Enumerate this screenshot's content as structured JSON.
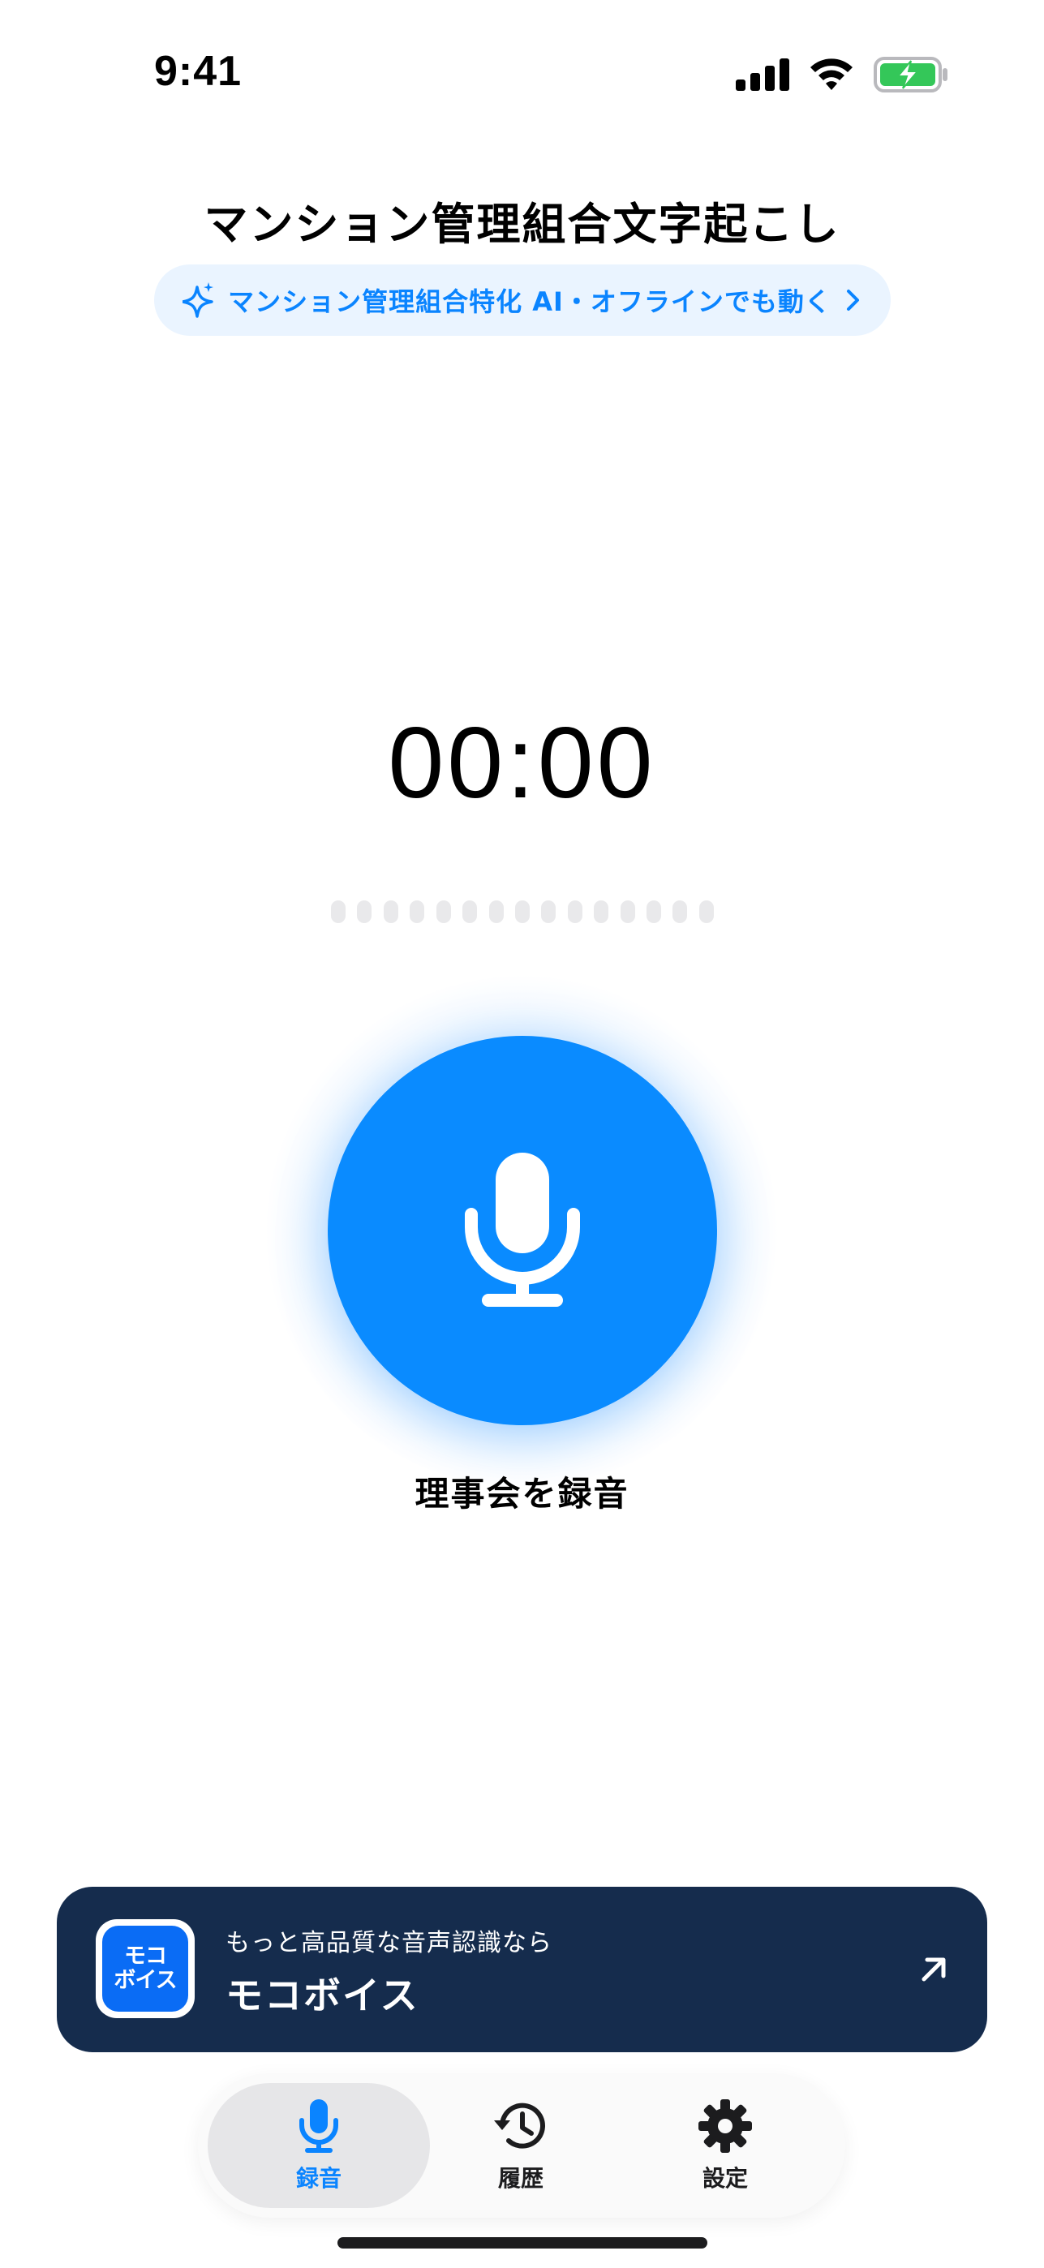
{
  "status_bar": {
    "time": "9:41",
    "icons": [
      "cellular-signal-icon",
      "wifi-icon",
      "battery-charging-icon"
    ]
  },
  "header": {
    "title": "マンション管理組合文字起こし",
    "ai_pill": {
      "icon": "sparkle-icon",
      "label": "マンション管理組合特化 AI・オフラインでも動く",
      "chevron": "chevron-right-icon"
    }
  },
  "recorder": {
    "timer": "00:00",
    "level_meter_dot_count": 15,
    "button_icon": "microphone-icon",
    "label": "理事会を録音"
  },
  "promo": {
    "logo_text": [
      "モコ",
      "ボイス"
    ],
    "subtitle": "もっと高品質な音声認識なら",
    "title": "モコボイス",
    "arrow_icon": "arrow-up-right-icon"
  },
  "tab_bar": {
    "tabs": [
      {
        "id": "record",
        "label": "録音",
        "icon": "microphone-icon",
        "active": true
      },
      {
        "id": "history",
        "label": "履歴",
        "icon": "history-icon",
        "active": false
      },
      {
        "id": "settings",
        "label": "設定",
        "icon": "gear-icon",
        "active": false
      }
    ]
  },
  "colors": {
    "accent": "#0a84ff",
    "record_button": "#0a8bff",
    "promo_background": "#152c4d",
    "pill_background": "#eaf4ff",
    "battery_fill": "#34c759"
  }
}
